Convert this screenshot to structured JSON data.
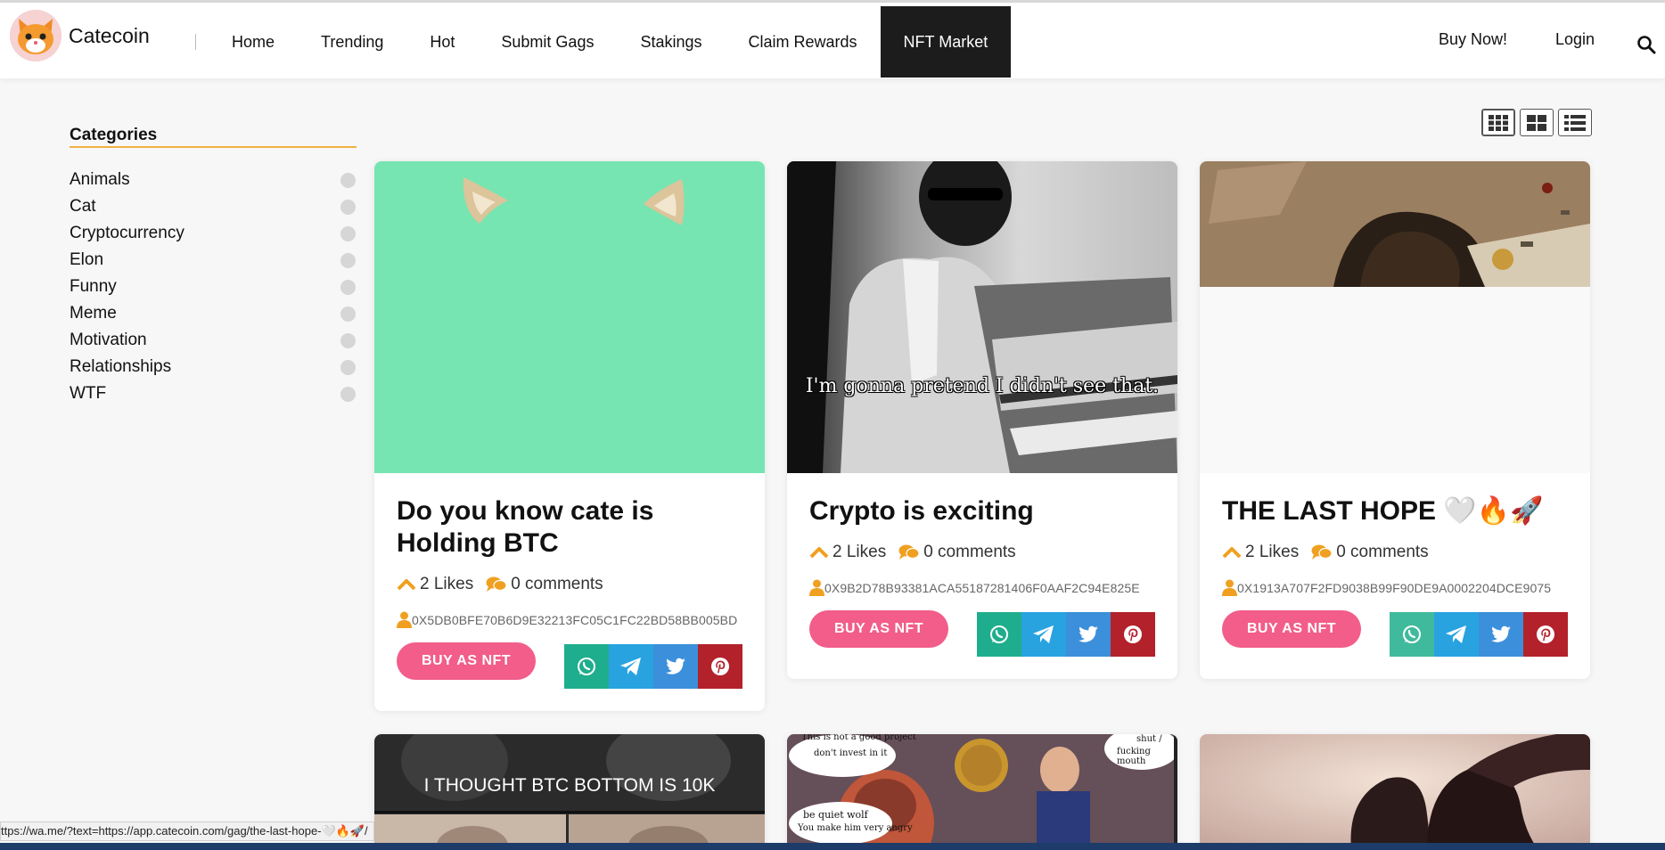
{
  "header": {
    "brand": "Catecoin",
    "nav": [
      "Home",
      "Trending",
      "Hot",
      "Submit Gags",
      "Stakings",
      "Claim Rewards",
      "NFT Market"
    ],
    "active_nav": "NFT Market",
    "buy_now": "Buy Now!",
    "login": "Login"
  },
  "sidebar": {
    "title": "Categories",
    "items": [
      "Animals",
      "Cat",
      "Cryptocurrency",
      "Elon",
      "Funny",
      "Meme",
      "Motivation",
      "Relationships",
      "WTF"
    ]
  },
  "cards": [
    {
      "title": "Do you know cate is Holding BTC",
      "likes": "2 Likes",
      "comments": "0 comments",
      "address": "0X5DB0BFE70B6D9E32213FC05C1FC22BD58BB005BD",
      "buy_label": "BUY AS NFT"
    },
    {
      "title": "Crypto is exciting",
      "image_caption": "I'm gonna pretend I didn't see that.",
      "likes": "2 Likes",
      "comments": "0 comments",
      "address": "0X9B2D78B93381ACA55187281406F0AAF2C94E825E",
      "buy_label": "BUY AS NFT"
    },
    {
      "title": "THE LAST HOPE 🤍🔥🚀",
      "likes": "2 Likes",
      "comments": "0 comments",
      "address": "0X1913A707F2FD9038B99F90DE9A0002204DCE9075",
      "buy_label": "BUY AS NFT"
    }
  ],
  "bottom_cards": [
    {
      "image_caption": "I THOUGHT BTC BOTTOM IS 10K"
    },
    {
      "speech": [
        "This is not a good project",
        "don't invest in it",
        "be quiet wolf",
        "You make him very angry",
        "shut /",
        "fucking mouth"
      ]
    },
    {}
  ],
  "statusbar": {
    "url": "ttps://wa.me/?text=https://app.catecoin.com/gag/the-last-hope-🤍🔥🚀/"
  },
  "colors": {
    "accent": "#f0b243",
    "buy_button": "#f25d8a",
    "whatsapp": "#1fae8d",
    "telegram": "#28a3e0",
    "twitter": "#3b8fdb",
    "pinterest": "#b3212b",
    "active_nav_bg": "#1c1c1c"
  },
  "icons": [
    "cat-logo-icon",
    "search-icon",
    "grid-3-icon",
    "grid-2-icon",
    "list-icon",
    "likes-chevron-icon",
    "comments-icon",
    "user-icon",
    "whatsapp-icon",
    "telegram-icon",
    "twitter-icon",
    "pinterest-icon"
  ]
}
